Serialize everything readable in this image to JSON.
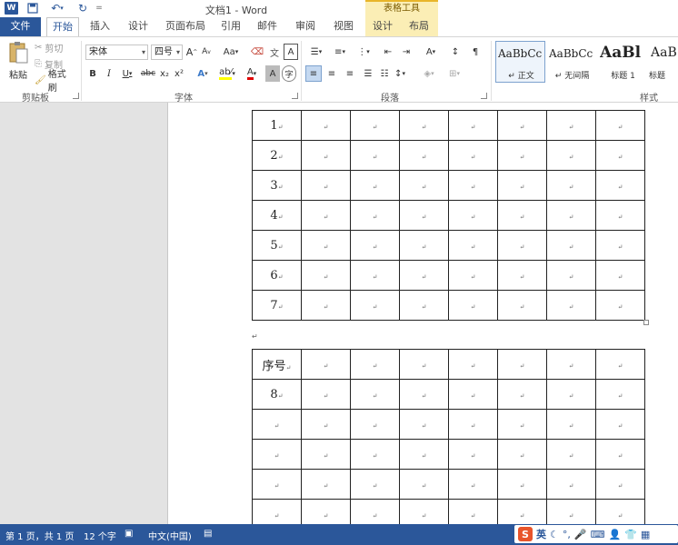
{
  "title_bar": {
    "doc_title": "文档1 - Word",
    "table_tools": "表格工具",
    "quick_access": {
      "save_icon": "save-icon",
      "undo_icon": "undo-icon",
      "redo_icon": "redo-icon",
      "more": "="
    },
    "undo_glyph": "↶",
    "redo_glyph": "↻"
  },
  "tabs": [
    {
      "label": "文件"
    },
    {
      "label": "开始"
    },
    {
      "label": "插入"
    },
    {
      "label": "设计"
    },
    {
      "label": "页面布局"
    },
    {
      "label": "引用"
    },
    {
      "label": "邮件"
    },
    {
      "label": "审阅"
    },
    {
      "label": "视图"
    },
    {
      "label": "设计"
    },
    {
      "label": "布局"
    }
  ],
  "clipboard": {
    "paste": "粘贴",
    "cut": "剪切",
    "copy": "复制",
    "format_painter": "格式刷",
    "group": "剪贴板"
  },
  "font": {
    "name": "宋体",
    "size": "四号",
    "group": "字体",
    "grow": "A",
    "shrink": "A",
    "case": "Aa",
    "bold": "B",
    "italic": "I",
    "underline": "U",
    "strike": "abc",
    "sub": "x₂",
    "sup": "x²",
    "effect": "A",
    "highlight": "ab⁄",
    "color": "A",
    "char_shade": "A",
    "enclose": "字"
  },
  "paragraph": {
    "group": "段落"
  },
  "styles": {
    "group": "样式",
    "items": [
      {
        "sample": "AaBbCc",
        "name": "↵ 正文"
      },
      {
        "sample": "AaBbCc",
        "name": "↵ 无间隔"
      },
      {
        "sample": "AaBl",
        "name": "标题 1"
      },
      {
        "sample": "AaB",
        "name": "标题"
      }
    ]
  },
  "table1": {
    "rows": [
      "1",
      "2",
      "3",
      "4",
      "5",
      "6",
      "7"
    ]
  },
  "table2": {
    "rows": [
      "序号",
      "8",
      "",
      "",
      "",
      ""
    ]
  },
  "marks": {
    "cell": "↵",
    "para": "↵"
  },
  "status": {
    "page": "第 1 页，共 1 页",
    "words": "12 个字",
    "language": "中文(中国)",
    "ime_logo": "S",
    "ime_mode": "英"
  },
  "colors": {
    "accent": "#2b579a",
    "table_tools": "#fbeeb5"
  }
}
